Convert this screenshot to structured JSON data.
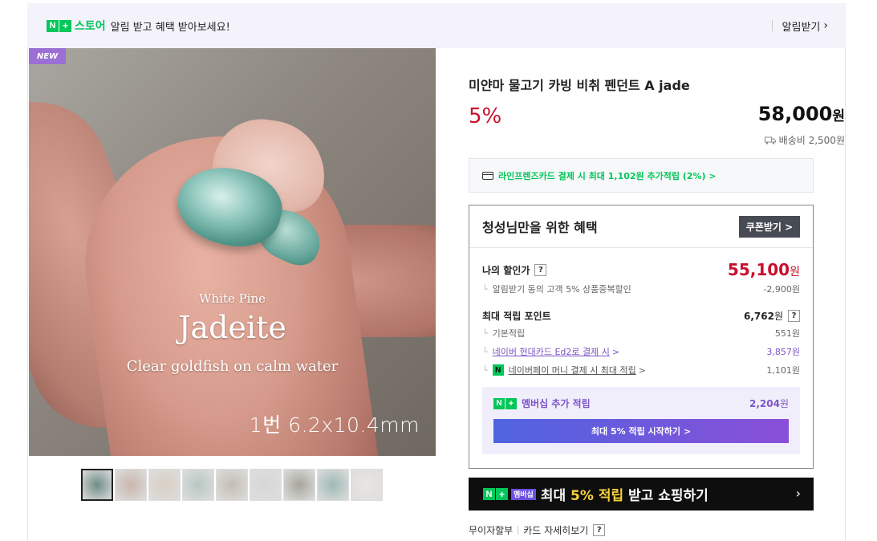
{
  "topbar": {
    "n_badge": "N",
    "plus_badge": "+",
    "store_label": "스토어",
    "message": "알림 받고 혜택 받아보세요!",
    "alarm_label": "알림받기",
    "chevron": "›"
  },
  "photo": {
    "new_badge": "NEW",
    "line1": "White Pine",
    "line2": "Jadeite",
    "line3": "Clear goldfish on calm water",
    "size_text": "1번 6.2x10.4mm"
  },
  "thumbnails": {
    "colors": [
      "#6f8d86",
      "#c9b7ad",
      "#d9cfc4",
      "#b8c8c2",
      "#c4bdb3",
      "#d6d8d6",
      "#a7a69c",
      "#9fbab4",
      "#e9e6e2"
    ]
  },
  "product": {
    "title": "미얀마 물고기 카빙 비취 펜던트 A jade",
    "discount": "5%",
    "price": "58,000",
    "price_unit": "원",
    "shipping": "배송비 2,500원"
  },
  "card_promo": {
    "text": "라인프렌즈카드 결제 시 최대 1,102원 추가적립 (2%) >"
  },
  "benefit": {
    "heading": "청성님만을 위한 혜택",
    "coupon_button": "쿠폰받기 >",
    "my_price_label": "나의 할인가",
    "my_price": "55,100",
    "my_price_unit": "원",
    "discount_note": "알림받기 동의 고객 5% 상품중복할인",
    "discount_amount": "-2,900원",
    "points_label": "최대 적립 포인트",
    "points_value": "6,762",
    "points_unit": "원",
    "basic_label": "기본적립",
    "basic_value": "551원",
    "card_label": "네이버 현대카드 Ed2로 결제 시",
    "card_value": "3,857원",
    "pay_badge": "N",
    "pay_label": "네이버페이 머니 결제 시 최대 적립",
    "pay_value": "1,101원",
    "question": "?",
    "chevron": ">"
  },
  "membership": {
    "label": "멤버십 추가 적립",
    "value": "2,204",
    "value_unit": "원",
    "button": "최대 5% 적립 시작하기 >"
  },
  "banner": {
    "badge": "멤버십",
    "text_pre": "최대 ",
    "text_hl": "5% 적립",
    "text_post": " 받고 쇼핑하기",
    "chevron": "›"
  },
  "footer": {
    "installment": "무이자할부",
    "card_detail": "카드 자세히보기",
    "question": "?"
  }
}
